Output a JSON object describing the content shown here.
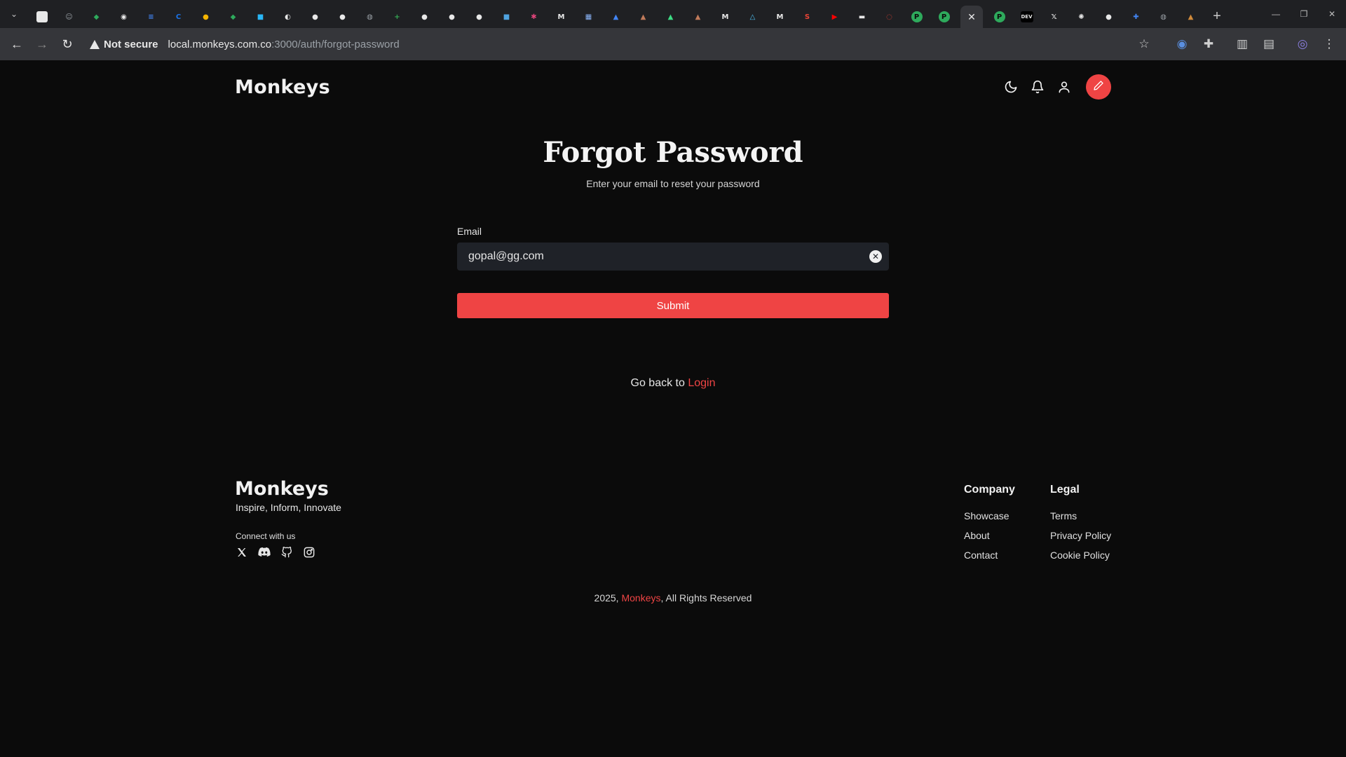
{
  "browser": {
    "tab_count_shown": 43,
    "tabs": [
      {
        "icon": "blank-doc-icon",
        "color": "#e8e8e8",
        "glyph": ""
      },
      {
        "icon": "ghost-icon",
        "color": "#9aa0a6",
        "glyph": "☺"
      },
      {
        "icon": "green-diamond-icon",
        "color": "#2eaa5c",
        "glyph": "◆"
      },
      {
        "icon": "eye-icon",
        "color": "#e8e8e8",
        "glyph": "◉"
      },
      {
        "icon": "docs-icon",
        "color": "#4285f4",
        "glyph": "≡"
      },
      {
        "icon": "c-icon",
        "color": "#1a73e8",
        "glyph": "C"
      },
      {
        "icon": "lock-yellow-icon",
        "color": "#f4b400",
        "glyph": "●"
      },
      {
        "icon": "green-diamond-icon",
        "color": "#2eaa5c",
        "glyph": "◆"
      },
      {
        "icon": "chat-blue-icon",
        "color": "#29b6f6",
        "glyph": "■"
      },
      {
        "icon": "circle-icon",
        "color": "#e8e8e8",
        "glyph": "◐"
      },
      {
        "icon": "github-icon",
        "color": "#e8e8e8",
        "glyph": "●"
      },
      {
        "icon": "github-icon",
        "color": "#e8e8e8",
        "glyph": "●"
      },
      {
        "icon": "globe-icon",
        "color": "#9aa0a6",
        "glyph": "◍"
      },
      {
        "icon": "sheets-icon",
        "color": "#34a853",
        "glyph": "+"
      },
      {
        "icon": "github-icon",
        "color": "#e8e8e8",
        "glyph": "●"
      },
      {
        "icon": "github-icon",
        "color": "#e8e8e8",
        "glyph": "●"
      },
      {
        "icon": "github-icon",
        "color": "#e8e8e8",
        "glyph": "●"
      },
      {
        "icon": "book-icon",
        "color": "#4fa3e0",
        "glyph": "■"
      },
      {
        "icon": "bug-icon",
        "color": "#e0447a",
        "glyph": "✱"
      },
      {
        "icon": "medium-icon",
        "color": "#e8e8e8",
        "glyph": "M"
      },
      {
        "icon": "grid-icon",
        "color": "#8ab4f8",
        "glyph": "▦"
      },
      {
        "icon": "download-icon",
        "color": "#4285f4",
        "glyph": "▲"
      },
      {
        "icon": "cloud-icon",
        "color": "#c07a5a",
        "glyph": "▲"
      },
      {
        "icon": "android-icon",
        "color": "#3ddc84",
        "glyph": "▲"
      },
      {
        "icon": "cloud-icon",
        "color": "#c07a5a",
        "glyph": "▲"
      },
      {
        "icon": "medium-icon",
        "color": "#e8e8e8",
        "glyph": "M"
      },
      {
        "icon": "triangle-icon",
        "color": "#4fc3f7",
        "glyph": "△"
      },
      {
        "icon": "medium-icon",
        "color": "#e8e8e8",
        "glyph": "M"
      },
      {
        "icon": "s-icon",
        "color": "#ea4335",
        "glyph": "S"
      },
      {
        "icon": "youtube-icon",
        "color": "#ff0000",
        "glyph": "▶"
      },
      {
        "icon": "card-icon",
        "color": "#e8e8e8",
        "glyph": "▬"
      },
      {
        "icon": "q-icon",
        "color": "#ea4335",
        "glyph": "◌"
      },
      {
        "icon": "p-icon",
        "color": "#2eaa5c",
        "glyph": "P"
      },
      {
        "icon": "p-icon",
        "color": "#2eaa5c",
        "glyph": "P"
      },
      {
        "icon": "p-icon",
        "color": "#2eaa5c",
        "glyph": "P"
      },
      {
        "icon": "dev-icon",
        "color": "#e8e8e8",
        "glyph": "DEV"
      },
      {
        "icon": "x-icon",
        "color": "#e8e8e8",
        "glyph": "𝕏"
      },
      {
        "icon": "openai-icon",
        "color": "#e8e8e8",
        "glyph": "✺"
      },
      {
        "icon": "github-icon",
        "color": "#e8e8e8",
        "glyph": "●"
      },
      {
        "icon": "puzzle-icon",
        "color": "#4285f4",
        "glyph": "✚"
      },
      {
        "icon": "globe-icon",
        "color": "#9aa0a6",
        "glyph": "◍"
      },
      {
        "icon": "tool-icon",
        "color": "#d08a3a",
        "glyph": "▲"
      }
    ],
    "active_tab_index": 33,
    "security_label": "Not secure",
    "url_host": "local.monkeys.com.co",
    "url_rest": ":3000/auth/forgot-password"
  },
  "header": {
    "logo": "M🐵nkeys",
    "logo_text": "Monkeys"
  },
  "main": {
    "title": "Forgot Password",
    "subtitle": "Enter your email to reset your password",
    "email_label": "Email",
    "email_value": "gopal@gg.com",
    "submit_label": "Submit",
    "goback_prefix": "Go back to",
    "goback_link": "Login"
  },
  "footer": {
    "logo_text": "Monkeys",
    "tagline": "Inspire, Inform, Innovate",
    "connect_label": "Connect with us",
    "company": {
      "heading": "Company",
      "links": [
        "Showcase",
        "About",
        "Contact"
      ]
    },
    "legal": {
      "heading": "Legal",
      "links": [
        "Terms",
        "Privacy Policy",
        "Cookie Policy"
      ]
    },
    "copyright_prefix": "2025,",
    "copyright_brand": "Monkeys",
    "copyright_suffix": ", All Rights Reserved"
  },
  "colors": {
    "accent": "#ef4444",
    "background": "#0b0b0b",
    "input_bg": "#1f2228"
  }
}
